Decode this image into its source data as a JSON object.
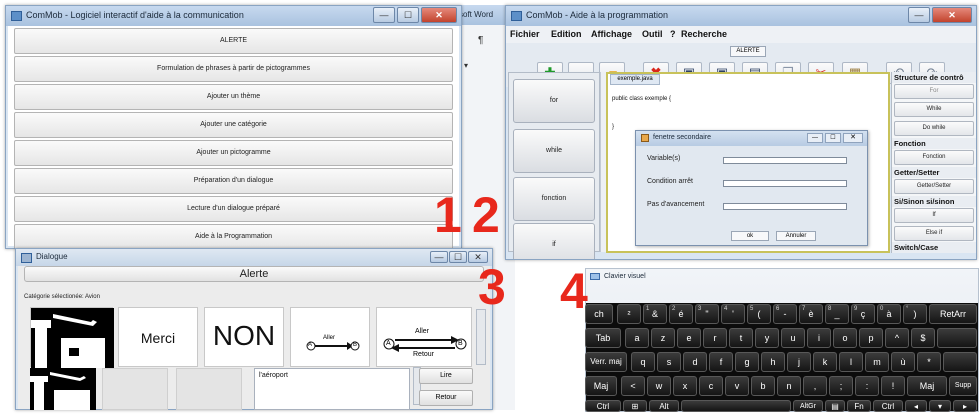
{
  "window1": {
    "title": "ComMob - Logiciel interactif d'aide à la communication",
    "buttons": [
      "ALERTE",
      "Formulation de phrases à partir de pictogrammes",
      "Ajouter un thème",
      "Ajouter une catégorie",
      "Ajouter un pictogramme",
      "Préparation d'un dialogue",
      "Lecture d'un dialogue préparé",
      "Aide à la Programmation"
    ],
    "behind_label": "soft Word",
    "number": "1"
  },
  "window2": {
    "title": "ComMob - Aide à la programmation",
    "menu": [
      "Fichier",
      "Edition",
      "Affichage",
      "Outil",
      "?",
      "Recherche"
    ],
    "alerte_button": "ALERTE",
    "toolbar_icons": [
      "plus-icon",
      "folder-icon",
      "folder-icon",
      "delete-icon",
      "save-icon",
      "save-all-icon",
      "save-as-icon",
      "copy-icon",
      "cut-icon",
      "paste-icon",
      "undo-icon",
      "redo-icon"
    ],
    "side_buttons": [
      "for",
      "while",
      "fonction",
      "if"
    ],
    "tab_label": "exemple.java",
    "code_lines": [
      "public class exemple {",
      "}"
    ],
    "dialog": {
      "title": "fenetre secondaire",
      "fields": [
        "Variable(s)",
        "Condition arrêt",
        "Pas d'avancement"
      ],
      "ok": "ok",
      "cancel": "Annuler"
    },
    "right_panel": {
      "head1": "Structure de contrô",
      "btn_for": "For",
      "btn_while": "While",
      "btn_dowhile": "Do while",
      "head2": "Fonction",
      "btn_fonction": "Fonction",
      "head3": "Getter/Setter",
      "btn_getset": "Getter/Setter",
      "head4": "Si/Sinon si/sinon",
      "btn_if": "If",
      "btn_elseif": "Else if",
      "head5": "Switch/Case"
    },
    "number": "2"
  },
  "window3": {
    "title": "Dialogue",
    "alert": "Alerte",
    "category": "Catégorie sélectionée: Avion",
    "pictos": [
      "Merci",
      "NON"
    ],
    "arrow_small": {
      "top": "Aller",
      "left": "A",
      "right": "B"
    },
    "arrow_big": {
      "top": "Aller",
      "bottom": "Retour",
      "left": "A",
      "right": "B"
    },
    "sentence": "l'aéroport",
    "read_btn": "Lire",
    "back_btn": "Retour",
    "number": "3"
  },
  "window4": {
    "title": "Clavier visuel",
    "row1": [
      "²",
      "&",
      "é",
      "\"",
      "'",
      "(",
      "-",
      "è",
      "_",
      "ç",
      "à",
      ")",
      "="
    ],
    "row1_sub": [
      "",
      "1",
      "2",
      "3",
      "4",
      "5",
      "6",
      "7",
      "8",
      "9",
      "0",
      "°",
      "+"
    ],
    "row1_first": "ch",
    "row1_last": "RetArr",
    "row2_first": "Tab",
    "row2": [
      "a",
      "z",
      "e",
      "r",
      "t",
      "y",
      "u",
      "i",
      "o",
      "p",
      "^",
      "$"
    ],
    "row3_first": "Verr. maj",
    "row3": [
      "q",
      "s",
      "d",
      "f",
      "g",
      "h",
      "j",
      "k",
      "l",
      "m",
      "ù",
      "*"
    ],
    "row4_first": "Maj",
    "row4": [
      "<",
      "w",
      "x",
      "c",
      "v",
      "b",
      "n",
      ",",
      ";",
      ":",
      "!"
    ],
    "row4_last": "Maj",
    "row4_end": "Supp",
    "row5": [
      "Ctrl",
      "Alt",
      "AltGr",
      "Fn",
      "Ctrl"
    ],
    "number": "4"
  }
}
